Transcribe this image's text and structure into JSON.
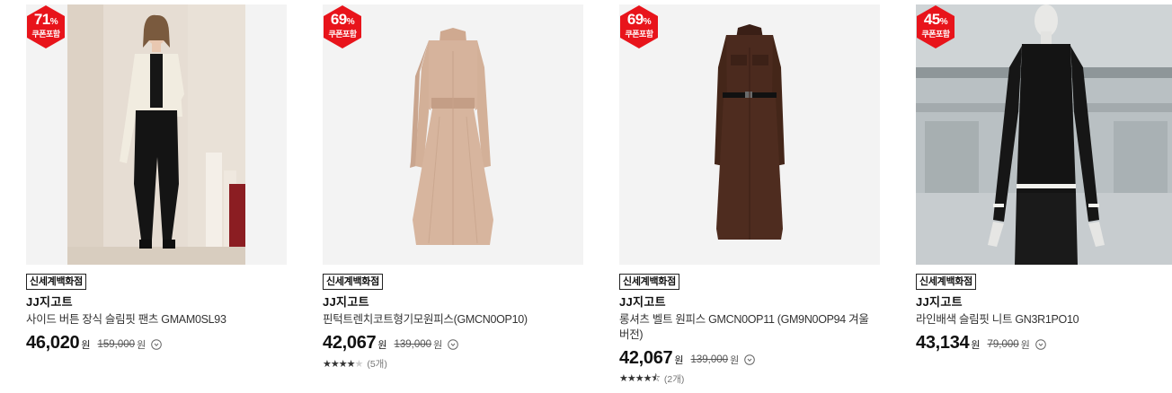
{
  "products": [
    {
      "discount": "71",
      "discount_unit": "%",
      "coupon": "쿠폰포함",
      "store": "신세계백화점",
      "brand": "JJ지고트",
      "name": "사이드 버튼 장식 슬림핏 팬츠 GMAM0SL93",
      "price": "46,020",
      "price_unit": "원",
      "original_price": "159,000",
      "original_unit": "원",
      "image": "model-cream-tweed-jacket-black-pants"
    },
    {
      "discount": "69",
      "discount_unit": "%",
      "coupon": "쿠폰포함",
      "store": "신세계백화점",
      "brand": "JJ지고트",
      "name": "핀턱트렌치코트형기모원피스(GMCN0OP10)",
      "price": "42,067",
      "price_unit": "원",
      "original_price": "139,000",
      "original_unit": "원",
      "rating": 4,
      "review_count": "(5개)",
      "image": "beige-trench-dress"
    },
    {
      "discount": "69",
      "discount_unit": "%",
      "coupon": "쿠폰포함",
      "store": "신세계백화점",
      "brand": "JJ지고트",
      "name": "롱셔츠 벨트 원피스 GMCN0OP11 (GM9N0OP94 겨울버전)",
      "price": "42,067",
      "price_unit": "원",
      "original_price": "139,000",
      "original_unit": "원",
      "rating": 4.5,
      "review_count": "(2개)",
      "image": "brown-shirt-dress-belt"
    },
    {
      "discount": "45",
      "discount_unit": "%",
      "coupon": "쿠폰포함",
      "store": "신세계백화점",
      "brand": "JJ지고트",
      "name": "라인배색 슬림핏 니트 GN3R1PO10",
      "price": "43,134",
      "price_unit": "원",
      "original_price": "79,000",
      "original_unit": "원",
      "image": "mannequin-black-rib-knit"
    }
  ],
  "colors": {
    "badge": "#e8141b",
    "text": "#222222",
    "star": "#333333",
    "star_empty": "#cfcfcf"
  }
}
